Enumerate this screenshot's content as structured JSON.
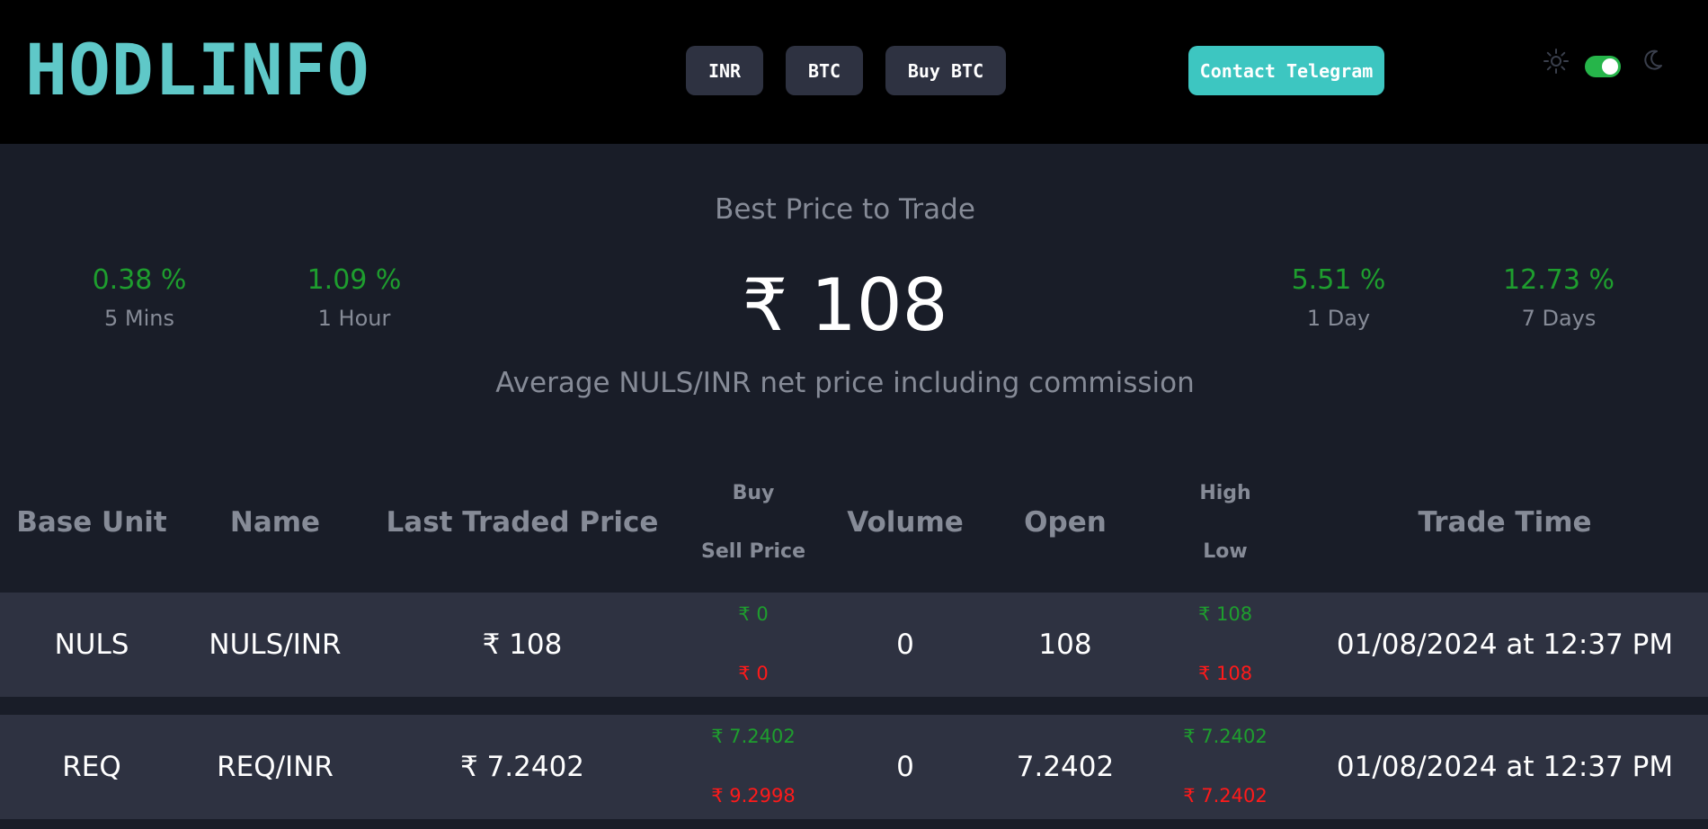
{
  "header": {
    "logo": "HODLINFO",
    "nav": [
      "INR",
      "BTC",
      "Buy BTC"
    ],
    "contact_label": "Contact Telegram",
    "theme_toggle_on": true
  },
  "hero": {
    "title": "Best Price to Trade",
    "price": "₹ 108",
    "subtitle": "Average NULS/INR net price including commission",
    "stats_left": [
      {
        "value": "0.38 %",
        "label": "5 Mins"
      },
      {
        "value": "1.09 %",
        "label": "1 Hour"
      }
    ],
    "stats_right": [
      {
        "value": "5.51 %",
        "label": "1 Day"
      },
      {
        "value": "12.73 %",
        "label": "7 Days"
      }
    ]
  },
  "table": {
    "headers": {
      "base_unit": "Base Unit",
      "name": "Name",
      "last_traded_price": "Last Traded Price",
      "buy": "Buy",
      "sell_price": "Sell Price",
      "volume": "Volume",
      "open": "Open",
      "high": "High",
      "low": "Low",
      "trade_time": "Trade Time"
    },
    "rows": [
      {
        "base_unit": "NULS",
        "name": "NULS/INR",
        "last_price": "₹ 108",
        "buy": "₹ 0",
        "sell": "₹ 0",
        "volume": "0",
        "open": "108",
        "high": "₹ 108",
        "low": "₹ 108",
        "trade_time": "01/08/2024 at 12:37 PM"
      },
      {
        "base_unit": "REQ",
        "name": "REQ/INR",
        "last_price": "₹ 7.2402",
        "buy": "₹ 7.2402",
        "sell": "₹ 9.2998",
        "volume": "0",
        "open": "7.2402",
        "high": "₹ 7.2402",
        "low": "₹ 7.2402",
        "trade_time": "01/08/2024 at 12:37 PM"
      }
    ]
  },
  "colors": {
    "accent": "#5fc8c8",
    "telegram": "#3dc6c1",
    "positive": "#1e9e2e",
    "negative": "#ff1a1a",
    "row_bg": "#2e3241",
    "page_bg": "#191d28"
  }
}
